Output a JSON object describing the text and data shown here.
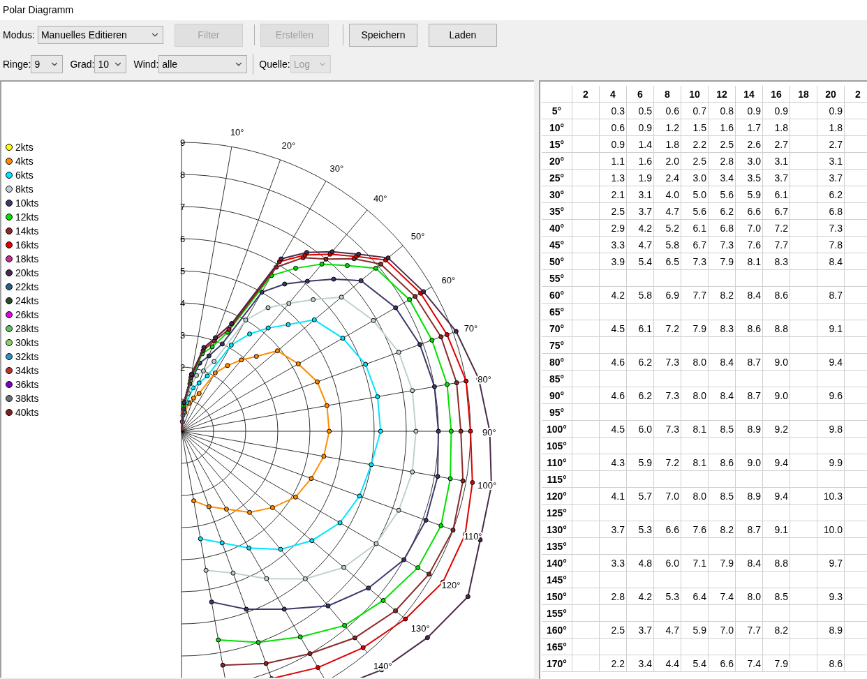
{
  "window": {
    "title": "Polar Diagramm"
  },
  "toolbar": {
    "mode": {
      "label": "Modus:",
      "value": "Manuelles Editieren"
    },
    "buttons": [
      {
        "label": "Filter",
        "disabled": true
      },
      {
        "label": "Erstellen",
        "disabled": true
      },
      {
        "label": "Speichern",
        "disabled": false
      },
      {
        "label": "Laden",
        "disabled": false
      }
    ]
  },
  "filters": [
    {
      "label": "Ringe:",
      "value": "9",
      "disabled": false
    },
    {
      "label": "Grad:",
      "value": "10",
      "disabled": false
    },
    {
      "label": "Wind:",
      "value": "alle",
      "disabled": false
    },
    {
      "label": "Quelle:",
      "value": "Log",
      "disabled": true
    }
  ],
  "legend": [
    {
      "label": "2kts",
      "color": "#ffff00"
    },
    {
      "label": "4kts",
      "color": "#ff8c00"
    },
    {
      "label": "6kts",
      "color": "#00e5ff"
    },
    {
      "label": "8kts",
      "color": "#c0d0d0"
    },
    {
      "label": "10kts",
      "color": "#3a3a6a"
    },
    {
      "label": "12kts",
      "color": "#00e000"
    },
    {
      "label": "14kts",
      "color": "#8b2a2a"
    },
    {
      "label": "16kts",
      "color": "#e00000"
    },
    {
      "label": "18kts",
      "color": "#c03090"
    },
    {
      "label": "20kts",
      "color": "#4a2a4a"
    },
    {
      "label": "22kts",
      "color": "#2a6080"
    },
    {
      "label": "24kts",
      "color": "#2a4a2a"
    },
    {
      "label": "26kts",
      "color": "#e000e0"
    },
    {
      "label": "28kts",
      "color": "#60c060"
    },
    {
      "label": "30kts",
      "color": "#90d060"
    },
    {
      "label": "32kts",
      "color": "#3090c0"
    },
    {
      "label": "34kts",
      "color": "#c03030"
    },
    {
      "label": "36kts",
      "color": "#8000c0"
    },
    {
      "label": "38kts",
      "color": "#707070"
    },
    {
      "label": "40kts",
      "color": "#802020"
    }
  ],
  "polar": {
    "ring_labels": [
      "9",
      "8",
      "7",
      "6",
      "5",
      "4",
      "3",
      "2"
    ],
    "angle_labels": [
      "10°",
      "20°",
      "30°",
      "40°",
      "50°",
      "60°",
      "70°",
      "80°",
      "90°",
      "100°",
      "110°",
      "120°",
      "130°",
      "140°"
    ]
  },
  "table": {
    "columns": [
      "2",
      "4",
      "6",
      "8",
      "10",
      "12",
      "14",
      "16",
      "18",
      "20",
      "2"
    ],
    "rows": [
      {
        "angle": "5°",
        "cells": [
          null,
          "0.3",
          "0.5",
          "0.6",
          "0.7",
          "0.8",
          "0.9",
          "0.9",
          null,
          "0.9",
          null
        ]
      },
      {
        "angle": "10°",
        "cells": [
          null,
          "0.6",
          "0.9",
          "1.2",
          "1.5",
          "1.6",
          "1.7",
          "1.8",
          null,
          "1.8",
          null
        ]
      },
      {
        "angle": "15°",
        "cells": [
          null,
          "0.9",
          "1.4",
          "1.8",
          "2.2",
          "2.5",
          "2.6",
          "2.7",
          null,
          "2.7",
          null
        ]
      },
      {
        "angle": "20°",
        "cells": [
          null,
          "1.1",
          "1.6",
          "2.0",
          "2.5",
          "2.8",
          "3.0",
          "3.1",
          null,
          "3.1",
          null
        ]
      },
      {
        "angle": "25°",
        "cells": [
          null,
          "1.3",
          "1.9",
          "2.4",
          "3.0",
          "3.4",
          "3.5",
          "3.7",
          null,
          "3.7",
          null
        ]
      },
      {
        "angle": "30°",
        "cells": [
          null,
          "2.1",
          "3.1",
          "4.0",
          "5.0",
          "5.6",
          "5.9",
          "6.1",
          null,
          "6.2",
          null
        ]
      },
      {
        "angle": "35°",
        "cells": [
          null,
          "2.5",
          "3.7",
          "4.7",
          "5.6",
          "6.2",
          "6.6",
          "6.7",
          null,
          "6.8",
          null
        ]
      },
      {
        "angle": "40°",
        "cells": [
          null,
          "2.9",
          "4.2",
          "5.2",
          "6.1",
          "6.8",
          "7.0",
          "7.2",
          null,
          "7.3",
          null
        ]
      },
      {
        "angle": "45°",
        "cells": [
          null,
          "3.3",
          "4.7",
          "5.8",
          "6.7",
          "7.3",
          "7.6",
          "7.7",
          null,
          "7.8",
          null
        ]
      },
      {
        "angle": "50°",
        "cells": [
          null,
          "3.9",
          "5.4",
          "6.5",
          "7.3",
          "7.9",
          "8.1",
          "8.3",
          null,
          "8.4",
          null
        ]
      },
      {
        "angle": "55°",
        "cells": [
          null,
          null,
          null,
          null,
          null,
          null,
          null,
          null,
          null,
          null,
          null
        ]
      },
      {
        "angle": "60°",
        "cells": [
          null,
          "4.2",
          "5.8",
          "6.9",
          "7.7",
          "8.2",
          "8.4",
          "8.6",
          null,
          "8.7",
          null
        ]
      },
      {
        "angle": "65°",
        "cells": [
          null,
          null,
          null,
          null,
          null,
          null,
          null,
          null,
          null,
          null,
          null
        ]
      },
      {
        "angle": "70°",
        "cells": [
          null,
          "4.5",
          "6.1",
          "7.2",
          "7.9",
          "8.3",
          "8.6",
          "8.8",
          null,
          "9.1",
          null
        ]
      },
      {
        "angle": "75°",
        "cells": [
          null,
          null,
          null,
          null,
          null,
          null,
          null,
          null,
          null,
          null,
          null
        ]
      },
      {
        "angle": "80°",
        "cells": [
          null,
          "4.6",
          "6.2",
          "7.3",
          "8.0",
          "8.4",
          "8.7",
          "9.0",
          null,
          "9.4",
          null
        ]
      },
      {
        "angle": "85°",
        "cells": [
          null,
          null,
          null,
          null,
          null,
          null,
          null,
          null,
          null,
          null,
          null
        ]
      },
      {
        "angle": "90°",
        "cells": [
          null,
          "4.6",
          "6.2",
          "7.3",
          "8.0",
          "8.4",
          "8.7",
          "9.0",
          null,
          "9.6",
          null
        ]
      },
      {
        "angle": "95°",
        "cells": [
          null,
          null,
          null,
          null,
          null,
          null,
          null,
          null,
          null,
          null,
          null
        ]
      },
      {
        "angle": "100°",
        "cells": [
          null,
          "4.5",
          "6.0",
          "7.3",
          "8.1",
          "8.5",
          "8.9",
          "9.2",
          null,
          "9.8",
          null
        ]
      },
      {
        "angle": "105°",
        "cells": [
          null,
          null,
          null,
          null,
          null,
          null,
          null,
          null,
          null,
          null,
          null
        ]
      },
      {
        "angle": "110°",
        "cells": [
          null,
          "4.3",
          "5.9",
          "7.2",
          "8.1",
          "8.6",
          "9.0",
          "9.4",
          null,
          "9.9",
          null
        ]
      },
      {
        "angle": "115°",
        "cells": [
          null,
          null,
          null,
          null,
          null,
          null,
          null,
          null,
          null,
          null,
          null
        ]
      },
      {
        "angle": "120°",
        "cells": [
          null,
          "4.1",
          "5.7",
          "7.0",
          "8.0",
          "8.5",
          "8.9",
          "9.4",
          null,
          "10.3",
          null
        ]
      },
      {
        "angle": "125°",
        "cells": [
          null,
          null,
          null,
          null,
          null,
          null,
          null,
          null,
          null,
          null,
          null
        ]
      },
      {
        "angle": "130°",
        "cells": [
          null,
          "3.7",
          "5.3",
          "6.6",
          "7.6",
          "8.2",
          "8.7",
          "9.1",
          null,
          "10.0",
          null
        ]
      },
      {
        "angle": "135°",
        "cells": [
          null,
          null,
          null,
          null,
          null,
          null,
          null,
          null,
          null,
          null,
          null
        ]
      },
      {
        "angle": "140°",
        "cells": [
          null,
          "3.3",
          "4.8",
          "6.0",
          "7.1",
          "7.9",
          "8.4",
          "8.8",
          null,
          "9.7",
          null
        ]
      },
      {
        "angle": "145°",
        "cells": [
          null,
          null,
          null,
          null,
          null,
          null,
          null,
          null,
          null,
          null,
          null
        ]
      },
      {
        "angle": "150°",
        "cells": [
          null,
          "2.8",
          "4.2",
          "5.3",
          "6.4",
          "7.4",
          "8.0",
          "8.5",
          null,
          "9.3",
          null
        ]
      },
      {
        "angle": "155°",
        "cells": [
          null,
          null,
          null,
          null,
          null,
          null,
          null,
          null,
          null,
          null,
          null
        ]
      },
      {
        "angle": "160°",
        "cells": [
          null,
          "2.5",
          "3.7",
          "4.7",
          "5.9",
          "7.0",
          "7.7",
          "8.2",
          null,
          "8.9",
          null
        ]
      },
      {
        "angle": "165°",
        "cells": [
          null,
          null,
          null,
          null,
          null,
          null,
          null,
          null,
          null,
          null,
          null
        ]
      },
      {
        "angle": "170°",
        "cells": [
          null,
          "2.2",
          "3.4",
          "4.4",
          "5.4",
          "6.6",
          "7.4",
          "7.9",
          null,
          "8.6",
          null
        ]
      }
    ]
  }
}
